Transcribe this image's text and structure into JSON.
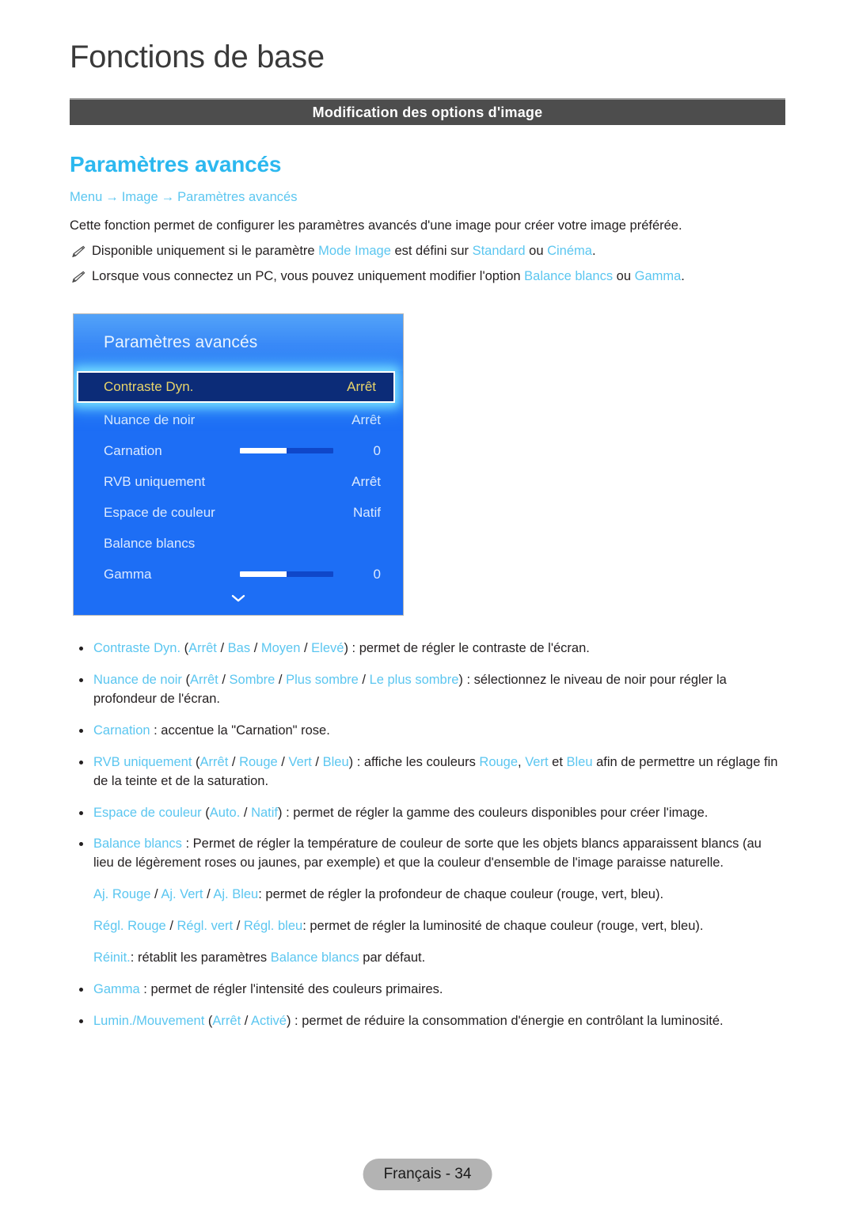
{
  "chapter": {
    "title": "Fonctions de base"
  },
  "section": {
    "label": "Modification des options d'image"
  },
  "heading": "Paramètres avancés",
  "breadcrumb": {
    "items": [
      "Menu",
      "Image",
      "Paramètres avancés"
    ],
    "separator": "→"
  },
  "intro": "Cette fonction permet de configurer les paramètres avancés d'une image pour créer votre image préférée.",
  "notes": [
    {
      "icon": "pencil-icon",
      "parts": [
        {
          "t": "Disponible uniquement si le paramètre ",
          "hl": false
        },
        {
          "t": "Mode Image",
          "hl": true
        },
        {
          "t": " est défini sur ",
          "hl": false
        },
        {
          "t": "Standard",
          "hl": true
        },
        {
          "t": " ou ",
          "hl": false
        },
        {
          "t": "Cinéma",
          "hl": true
        },
        {
          "t": ".",
          "hl": false
        }
      ]
    },
    {
      "icon": "pencil-icon",
      "parts": [
        {
          "t": "Lorsque vous connectez un PC, vous pouvez uniquement modifier l'option ",
          "hl": false
        },
        {
          "t": "Balance blancs",
          "hl": true
        },
        {
          "t": " ou ",
          "hl": false
        },
        {
          "t": "Gamma",
          "hl": true
        },
        {
          "t": ".",
          "hl": false
        }
      ]
    }
  ],
  "osd": {
    "title": "Paramètres avancés",
    "selected_index": 0,
    "scroll_indicator": "chevron-down-icon",
    "rows": [
      {
        "label": "Contraste Dyn.",
        "value": "Arrêt",
        "type": "value",
        "selected": true
      },
      {
        "label": "Nuance de noir",
        "value": "Arrêt",
        "type": "value",
        "selected": false
      },
      {
        "label": "Carnation",
        "value": "0",
        "type": "slider",
        "slider_percent": 50,
        "selected": false
      },
      {
        "label": "RVB uniquement",
        "value": "Arrêt",
        "type": "value",
        "selected": false
      },
      {
        "label": "Espace de couleur",
        "value": "Natif",
        "type": "value",
        "selected": false
      },
      {
        "label": "Balance blancs",
        "value": "",
        "type": "value",
        "selected": false
      },
      {
        "label": "Gamma",
        "value": "0",
        "type": "slider",
        "slider_percent": 50,
        "selected": false
      }
    ]
  },
  "bullets": [
    {
      "parts": [
        {
          "t": "Contraste Dyn.",
          "hl": true
        },
        {
          "t": " (",
          "hl": false
        },
        {
          "t": "Arrêt",
          "hl": true
        },
        {
          "t": " / ",
          "hl": false
        },
        {
          "t": "Bas",
          "hl": true
        },
        {
          "t": " / ",
          "hl": false
        },
        {
          "t": "Moyen",
          "hl": true
        },
        {
          "t": " / ",
          "hl": false
        },
        {
          "t": "Elevé",
          "hl": true
        },
        {
          "t": ") : permet de régler le contraste de l'écran.",
          "hl": false
        }
      ]
    },
    {
      "parts": [
        {
          "t": "Nuance de noir",
          "hl": true
        },
        {
          "t": " (",
          "hl": false
        },
        {
          "t": "Arrêt",
          "hl": true
        },
        {
          "t": " / ",
          "hl": false
        },
        {
          "t": "Sombre",
          "hl": true
        },
        {
          "t": " / ",
          "hl": false
        },
        {
          "t": "Plus sombre",
          "hl": true
        },
        {
          "t": " / ",
          "hl": false
        },
        {
          "t": "Le plus sombre",
          "hl": true
        },
        {
          "t": ") : sélectionnez le niveau de noir pour régler la profondeur de l'écran.",
          "hl": false
        }
      ]
    },
    {
      "parts": [
        {
          "t": "Carnation",
          "hl": true
        },
        {
          "t": " : accentue la \"Carnation\" rose.",
          "hl": false
        }
      ]
    },
    {
      "parts": [
        {
          "t": "RVB uniquement",
          "hl": true
        },
        {
          "t": " (",
          "hl": false
        },
        {
          "t": "Arrêt",
          "hl": true
        },
        {
          "t": " / ",
          "hl": false
        },
        {
          "t": "Rouge",
          "hl": true
        },
        {
          "t": " / ",
          "hl": false
        },
        {
          "t": "Vert",
          "hl": true
        },
        {
          "t": " / ",
          "hl": false
        },
        {
          "t": "Bleu",
          "hl": true
        },
        {
          "t": ") : affiche les couleurs ",
          "hl": false
        },
        {
          "t": "Rouge",
          "hl": true
        },
        {
          "t": ", ",
          "hl": false
        },
        {
          "t": "Vert",
          "hl": true
        },
        {
          "t": " et ",
          "hl": false
        },
        {
          "t": "Bleu",
          "hl": true
        },
        {
          "t": " afin de permettre un réglage fin de la teinte et de la saturation.",
          "hl": false
        }
      ]
    },
    {
      "parts": [
        {
          "t": "Espace de couleur",
          "hl": true
        },
        {
          "t": " (",
          "hl": false
        },
        {
          "t": "Auto.",
          "hl": true
        },
        {
          "t": " / ",
          "hl": false
        },
        {
          "t": "Natif",
          "hl": true
        },
        {
          "t": ") : permet de régler la gamme des couleurs disponibles pour créer l'image.",
          "hl": false
        }
      ]
    },
    {
      "parts": [
        {
          "t": "Balance blancs",
          "hl": true
        },
        {
          "t": " : Permet de régler la température de couleur de sorte que les objets blancs apparaissent blancs (au lieu de légèrement roses ou jaunes, par exemple) et que la couleur d'ensemble de l'image paraisse naturelle.",
          "hl": false
        }
      ],
      "sub_lines": [
        {
          "parts": [
            {
              "t": "Aj. Rouge",
              "hl": true
            },
            {
              "t": " / ",
              "hl": false
            },
            {
              "t": "Aj. Vert",
              "hl": true
            },
            {
              "t": " / ",
              "hl": false
            },
            {
              "t": "Aj. Bleu",
              "hl": true
            },
            {
              "t": ": permet de régler la profondeur de chaque couleur (rouge, vert, bleu).",
              "hl": false
            }
          ]
        },
        {
          "parts": [
            {
              "t": "Régl. Rouge",
              "hl": true
            },
            {
              "t": " / ",
              "hl": false
            },
            {
              "t": "Régl. vert",
              "hl": true
            },
            {
              "t": " / ",
              "hl": false
            },
            {
              "t": "Régl. bleu",
              "hl": true
            },
            {
              "t": ": permet de régler la luminosité de chaque couleur (rouge, vert, bleu).",
              "hl": false
            }
          ]
        },
        {
          "parts": [
            {
              "t": "Réinit.",
              "hl": true
            },
            {
              "t": ": rétablit les paramètres ",
              "hl": false
            },
            {
              "t": "Balance blancs",
              "hl": true
            },
            {
              "t": " par défaut.",
              "hl": false
            }
          ]
        }
      ]
    },
    {
      "parts": [
        {
          "t": "Gamma",
          "hl": true
        },
        {
          "t": " : permet de régler l'intensité des couleurs primaires.",
          "hl": false
        }
      ]
    },
    {
      "parts": [
        {
          "t": "Lumin./Mouvement",
          "hl": true
        },
        {
          "t": " (",
          "hl": false
        },
        {
          "t": "Arrêt",
          "hl": true
        },
        {
          "t": " / ",
          "hl": false
        },
        {
          "t": "Activé",
          "hl": true
        },
        {
          "t": ") : permet de réduire la consommation d'énergie en contrôlant la luminosité.",
          "hl": false
        }
      ]
    }
  ],
  "footer": {
    "label": "Français - 34"
  },
  "colors": {
    "accent_cyan": "#5bc6f0",
    "heading_cyan": "#2cb8ef",
    "section_bar": "#4d4d4d",
    "osd_blue": "#1d6ef5",
    "osd_selected_bg": "#0c2c78",
    "osd_selected_text": "#e8d46a",
    "footer_pill": "#b3b3b3"
  }
}
